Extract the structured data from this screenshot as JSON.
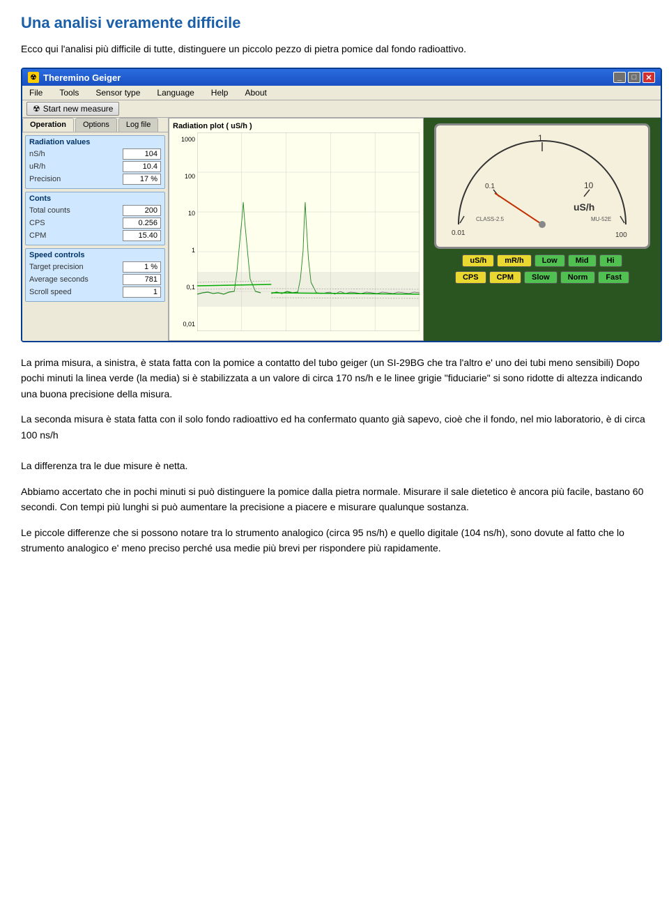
{
  "page": {
    "title": "Una analisi veramente difficile",
    "intro": "Ecco qui l'analisi più difficile di tutte, distinguere un piccolo pezzo di pietra pomice dal fondo radioattivo."
  },
  "window": {
    "title": "Theremino Geiger",
    "menu": [
      "File",
      "Tools",
      "Sensor type",
      "Language",
      "Help",
      "About"
    ],
    "toolbar_btn": "Start new measure",
    "tabs": [
      "Operation",
      "Options",
      "Log file"
    ],
    "active_tab": "Operation"
  },
  "radiation_values": {
    "section_title": "Radiation values",
    "fields": [
      {
        "label": "nS/h",
        "value": "104"
      },
      {
        "label": "uR/h",
        "value": "10.4"
      },
      {
        "label": "Precision",
        "value": "17 %"
      }
    ]
  },
  "conts": {
    "section_title": "Conts",
    "fields": [
      {
        "label": "Total counts",
        "value": "200"
      },
      {
        "label": "CPS",
        "value": "0.256"
      },
      {
        "label": "CPM",
        "value": "15.40"
      }
    ]
  },
  "speed_controls": {
    "section_title": "Speed controls",
    "fields": [
      {
        "label": "Target precision",
        "value": "1 %"
      },
      {
        "label": "Average seconds",
        "value": "781"
      },
      {
        "label": "Scroll speed",
        "value": "1"
      }
    ]
  },
  "chart": {
    "title": "Radiation plot ( uS/h )",
    "y_labels": [
      "1000",
      "100",
      "10",
      "1",
      "0,1",
      "0,01"
    ]
  },
  "gauge": {
    "unit": "uS/h",
    "class": "CLASS-2.5",
    "model": "MU-52E",
    "scale_labels": [
      "0.01",
      "0.1",
      "1",
      "10",
      "100"
    ],
    "buttons_row1": [
      "uS/h",
      "mR/h",
      "Low",
      "Mid",
      "Hi"
    ],
    "buttons_row2": [
      "CPS",
      "CPM",
      "Slow",
      "Norm",
      "Fast"
    ]
  },
  "paragraphs": [
    "La prima misura, a sinistra, è stata fatta con la pomice a contatto del tubo geiger (un SI-29BG che tra l'altro e' uno dei tubi meno sensibili) Dopo pochi minuti la linea verde (la media) si è stabilizzata a un valore di circa 170 ns/h e le linee grigie \"fiduciarie\" si sono ridotte di altezza indicando una buona precisione della misura.",
    "La seconda misura è stata fatta con il solo fondo radioattivo ed ha confermato quanto già sapevo, cioè che il fondo, nel mio laboratorio, è di circa 100 ns/h\n\nLa differenza tra le due misure è netta.",
    "Abbiamo accertato che in pochi minuti si può distinguere la pomice dalla pietra normale. Misurare il sale dietetico è ancora più facile, bastano 60 secondi. Con tempi più lunghi si può aumentare la precisione a piacere e misurare qualunque sostanza.",
    "Le piccole differenze che si possono notare tra lo strumento analogico (circa 95 ns/h) e quello digitale (104 ns/h), sono dovute al fatto che lo strumento analogico e' meno preciso perché usa medie più brevi per rispondere più rapidamente."
  ]
}
